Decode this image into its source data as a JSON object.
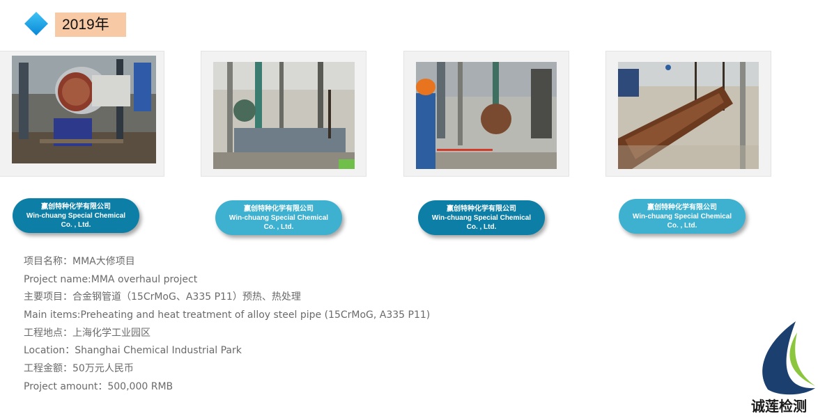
{
  "header": {
    "year_label": "2019年",
    "diamond_color": "#1a9be6",
    "year_bg": "#f8c9a5"
  },
  "photos": [
    {
      "alt": "heat exchanger tube bundle at industrial site"
    },
    {
      "alt": "steel pipe rack with chain hoist"
    },
    {
      "alt": "worker in orange hard hat beside tube bundle"
    },
    {
      "alt": "rusty tube bundle lifted by chain hoists"
    }
  ],
  "company_badges": [
    {
      "cn": "赢创特种化学有限公司",
      "en_line1": "Win-chuang Special Chemical",
      "en_line2": "Co. , Ltd.",
      "color": "#0d7fa6"
    },
    {
      "cn": "赢创特种化学有限公司",
      "en_line1": "Win-chuang Special Chemical",
      "en_line2": "Co. , Ltd.",
      "color": "#3db1cf"
    },
    {
      "cn": "赢创特种化学有限公司",
      "en_line1": "Win-chuang Special Chemical",
      "en_line2": "Co. , Ltd.",
      "color": "#0d7fa6"
    },
    {
      "cn": "赢创特种化学有限公司",
      "en_line1": "Win-chuang Special Chemical",
      "en_line2": "Co. , Ltd.",
      "color": "#3db1cf"
    }
  ],
  "project_info": {
    "name_cn": "项目名称：MMA大修项目",
    "name_en": "Project name:MMA overhaul project",
    "items_cn": "主要项目：合金钢管道（15CrMoG、A335 P11）预热、热处理",
    "items_en": "Main items:Preheating and heat treatment of alloy steel pipe (15CrMoG, A335 P11)",
    "location_cn": "工程地点：上海化学工业园区",
    "location_en": "Location：Shanghai Chemical Industrial Park",
    "amount_cn": "工程金额：50万元人民币",
    "amount_en": "Project amount：500,000 RMB"
  },
  "logo": {
    "text": "诚莲检测",
    "primary_color": "#1b3f6e",
    "accent_color": "#8cc63f"
  }
}
